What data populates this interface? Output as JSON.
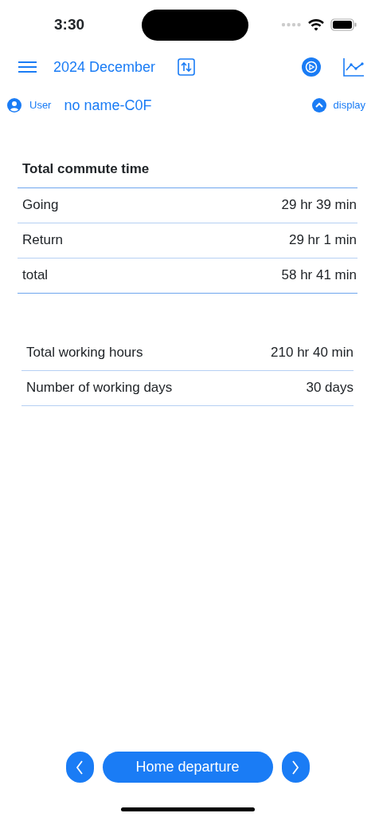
{
  "status_bar": {
    "time": "3:30"
  },
  "toolbar": {
    "title": "2024 December"
  },
  "user_row": {
    "label": "User",
    "name": "no name-C0F",
    "toggle_label": "display",
    "expanded": true
  },
  "commute": {
    "title": "Total commute time",
    "rows": [
      {
        "label": "Going",
        "value": "29 hr 39 min"
      },
      {
        "label": "Return",
        "value": "29 hr 1 min"
      },
      {
        "label": "total",
        "value": "58 hr 41 min"
      }
    ]
  },
  "work": {
    "rows": [
      {
        "label": "Total working hours",
        "value": "210 hr 40 min"
      },
      {
        "label": "Number of working days",
        "value": "30 days"
      }
    ]
  },
  "bottom_bar": {
    "mode_button": "Home departure"
  }
}
